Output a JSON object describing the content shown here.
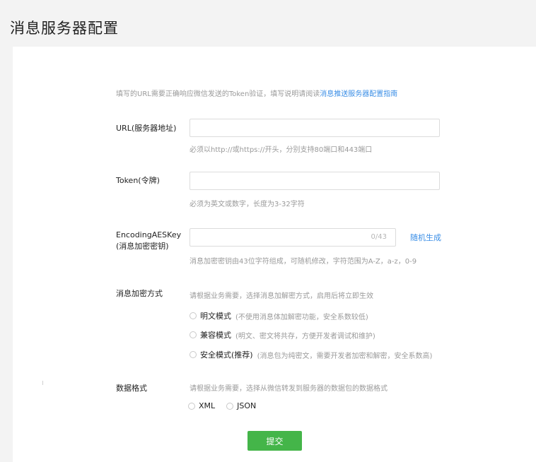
{
  "page": {
    "title": "消息服务器配置"
  },
  "intro": {
    "text": "填写的URL需要正确响应微信发送的Token验证，填写说明请阅读",
    "link": "消息推送服务器配置指南"
  },
  "url": {
    "label": "URL(服务器地址)",
    "value": "",
    "hint": "必须以http://或https://开头，分别支持80端口和443端口"
  },
  "token": {
    "label": "Token(令牌)",
    "value": "",
    "hint": "必须为英文或数字，长度为3-32字符"
  },
  "aeskey": {
    "label_line1": "EncodingAESKey",
    "label_line2": "(消息加密密钥)",
    "value": "",
    "counter": "0/43",
    "random_link": "随机生成",
    "hint": "消息加密密钥由43位字符组成，可随机修改，字符范围为A-Z，a-z，0-9"
  },
  "encryption": {
    "label": "消息加密方式",
    "hint": "请根据业务需要，选择消息加解密方式，启用后将立即生效",
    "options": [
      {
        "label": "明文模式",
        "desc": "(不使用消息体加解密功能，安全系数较低)"
      },
      {
        "label": "兼容模式",
        "desc": "(明文、密文将共存，方便开发者调试和维护)"
      },
      {
        "label": "安全模式(推荐)",
        "desc": "(消息包为纯密文，需要开发者加密和解密，安全系数高)"
      }
    ]
  },
  "data_format": {
    "label": "数据格式",
    "hint": "请根据业务需要，选择从微信转发到服务器的数据包的数据格式",
    "options": [
      "XML",
      "JSON"
    ]
  },
  "submit": {
    "label": "提交"
  },
  "colors": {
    "accent_green": "#44b549",
    "link_blue": "#3a8ee6"
  }
}
